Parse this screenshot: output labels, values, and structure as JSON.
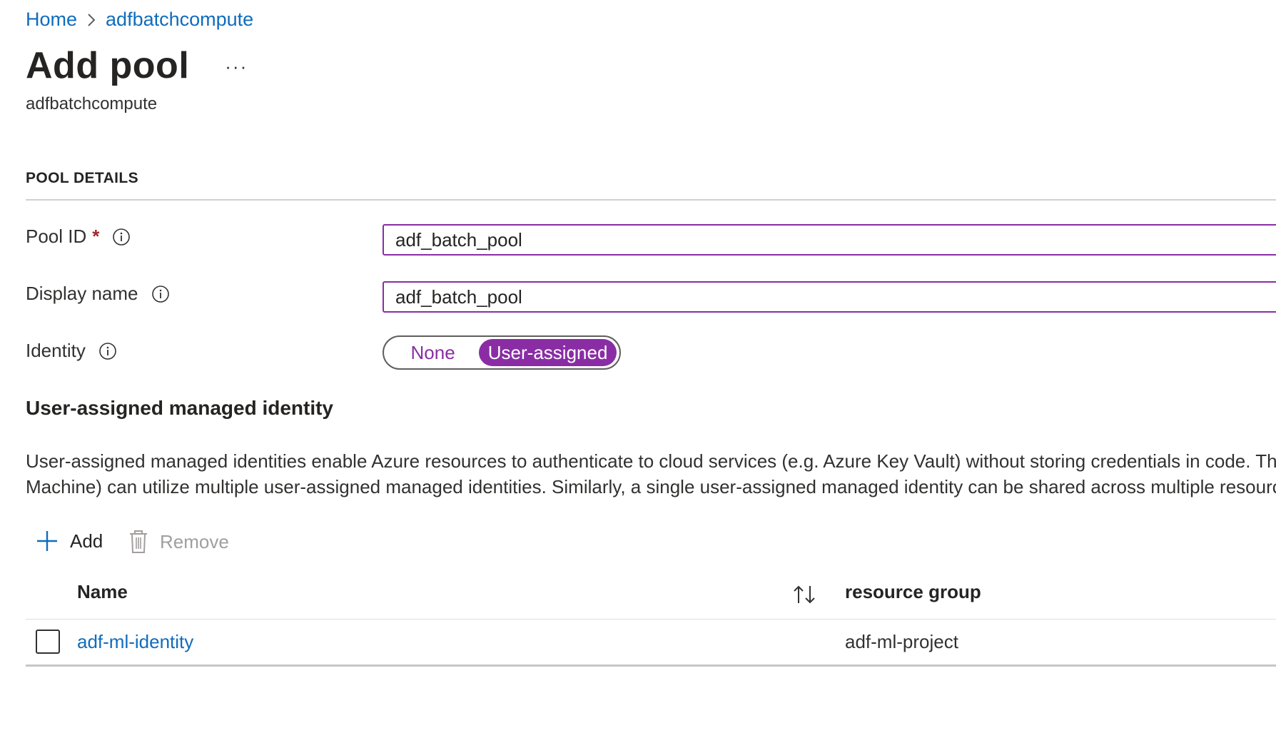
{
  "breadcrumb": {
    "home": "Home",
    "current": "adfbatchcompute"
  },
  "header": {
    "title": "Add pool",
    "more": "···",
    "subtitle": "adfbatchcompute"
  },
  "pool_details": {
    "section_title": "POOL DETAILS",
    "pool_id": {
      "label": "Pool ID",
      "required": "*",
      "value": "adf_batch_pool"
    },
    "display_name": {
      "label": "Display name",
      "value": "adf_batch_pool"
    },
    "identity": {
      "label": "Identity",
      "options": [
        "None",
        "User-assigned"
      ],
      "selected": "User-assigned"
    }
  },
  "managed_identity": {
    "title": "User-assigned managed identity",
    "description_line1": "User-assigned managed identities enable Azure resources to authenticate to cloud services (e.g. Azure Key Vault) without storing credentials in code. This",
    "description_line2": "Machine) can utilize multiple user-assigned managed identities. Similarly, a single user-assigned managed identity can be shared across multiple resource",
    "commands": {
      "add": "Add",
      "remove": "Remove"
    },
    "table": {
      "columns": [
        "Name",
        "resource group"
      ],
      "rows": [
        {
          "name": "adf-ml-identity",
          "resource_group": "adf-ml-project"
        }
      ]
    }
  },
  "colors": {
    "accent": "#8a2da5",
    "link": "#0f6cbd",
    "required": "#a4262c"
  }
}
